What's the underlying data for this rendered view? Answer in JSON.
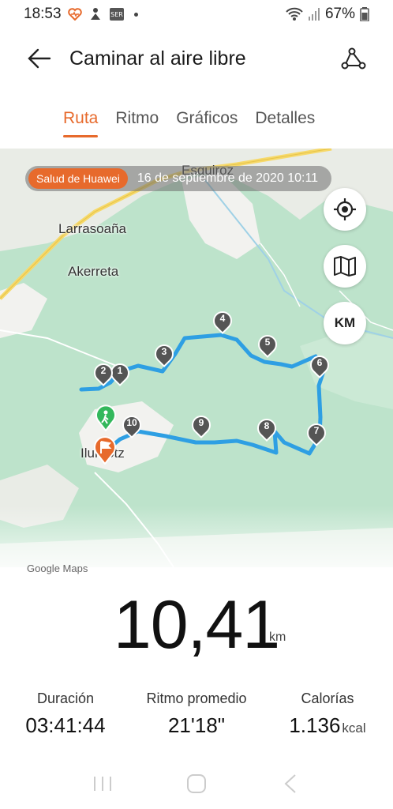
{
  "status_bar": {
    "time": "18:53",
    "battery": "67%",
    "icons": [
      "heart-rate-icon",
      "huawei-health-icon",
      "sim-icon",
      "dot-icon",
      "wifi-icon",
      "signal-icon",
      "battery-icon"
    ]
  },
  "app_bar": {
    "title": "Caminar al aire libre",
    "back_icon": "back-arrow-icon",
    "route_icon": "route-icon"
  },
  "tabs": [
    {
      "label": "Ruta",
      "active": true
    },
    {
      "label": "Ritmo",
      "active": false
    },
    {
      "label": "Gráficos",
      "active": false
    },
    {
      "label": "Detalles",
      "active": false
    }
  ],
  "map": {
    "source_badge": "Salud de Huawei",
    "date": "16 de septiembre de 2020 10:11",
    "places": [
      "Esquiroz",
      "Larrasoaña",
      "Akerreta",
      "Ilurdotz"
    ],
    "buttons": {
      "locate_icon": "locate-icon",
      "map_icon": "map-layers-icon",
      "km_label": "KM"
    },
    "km_markers": [
      "1",
      "2",
      "3",
      "4",
      "5",
      "6",
      "7",
      "8",
      "9",
      "10"
    ],
    "attribution": "Google Maps",
    "route_color": "#2e9fe3",
    "accent_color": "#e76a2c"
  },
  "summary": {
    "distance": "10,41",
    "distance_unit": "km",
    "stats": [
      {
        "label": "Duración",
        "value": "03:41:44",
        "unit": ""
      },
      {
        "label": "Ritmo promedio",
        "value": "21'18\"",
        "unit": ""
      },
      {
        "label": "Calorías",
        "value": "1.136",
        "unit": "kcal"
      }
    ]
  },
  "nav_bar": {
    "icons": [
      "recent-apps-icon",
      "home-icon",
      "back-icon"
    ]
  }
}
